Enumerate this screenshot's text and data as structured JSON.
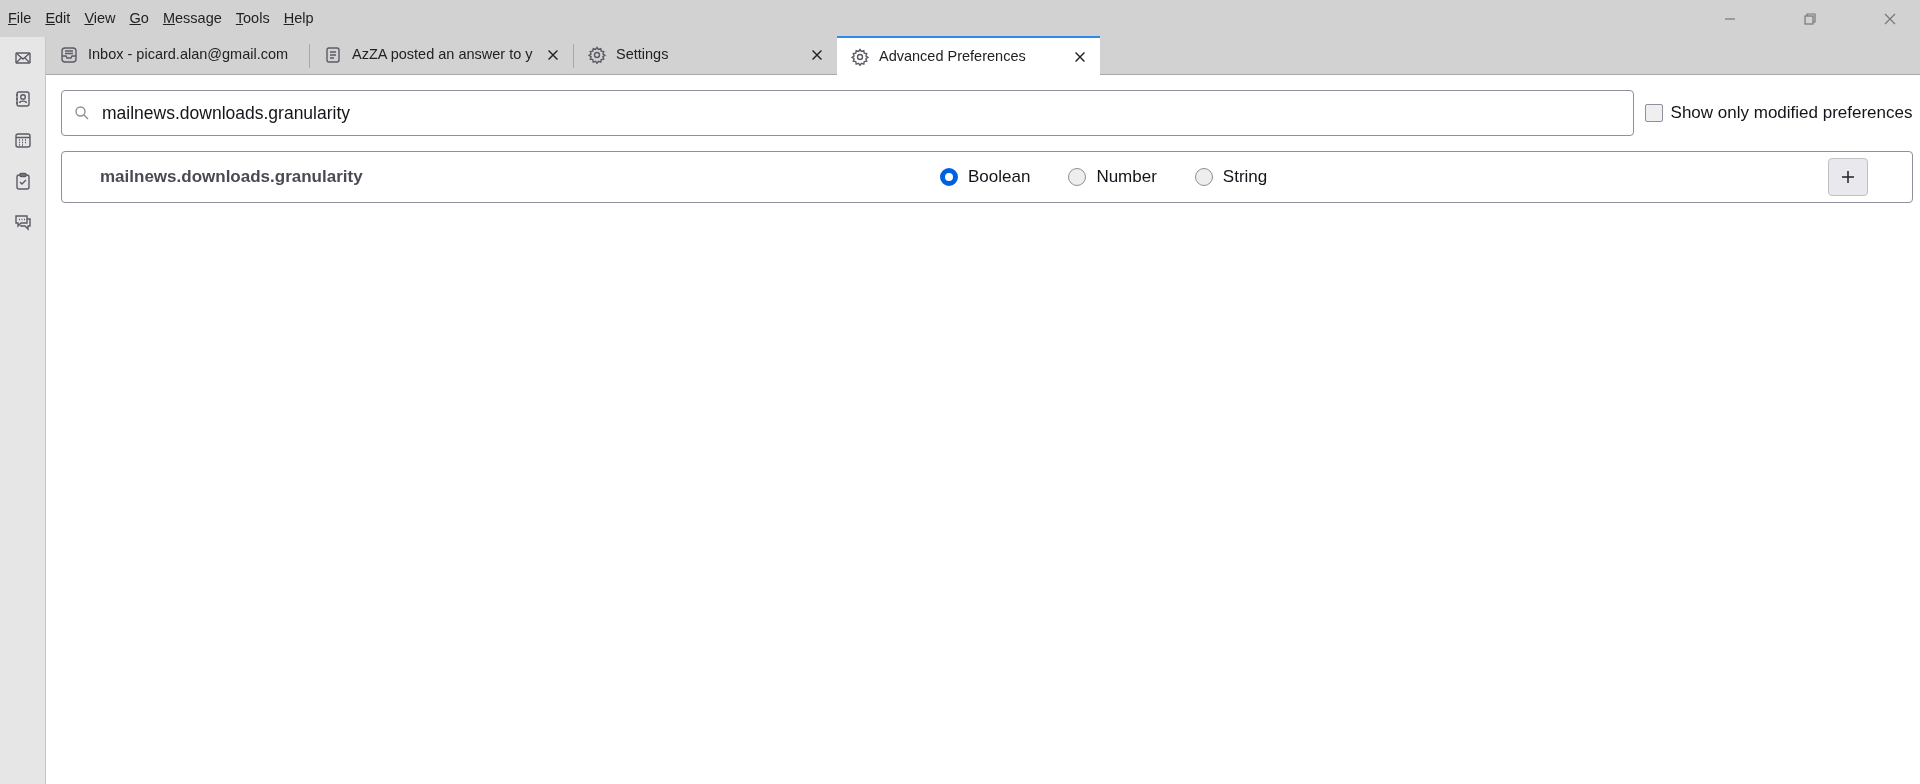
{
  "menu": [
    "File",
    "Edit",
    "View",
    "Go",
    "Message",
    "Tools",
    "Help"
  ],
  "sidebar": {
    "items": [
      {
        "kind": "mail"
      },
      {
        "kind": "contacts"
      },
      {
        "kind": "calendar"
      },
      {
        "kind": "tasks"
      },
      {
        "kind": "chat"
      }
    ]
  },
  "tabs": [
    {
      "kind": "inbox",
      "label": "Inbox - picard.alan@gmail.com",
      "selected": false,
      "closable": false
    },
    {
      "kind": "document",
      "label": "AzZA posted an answer to y",
      "selected": false,
      "closable": true
    },
    {
      "kind": "settings",
      "label": "Settings",
      "selected": false,
      "closable": true
    },
    {
      "kind": "settings",
      "label": "Advanced Preferences",
      "selected": true,
      "closable": true
    }
  ],
  "search": {
    "value": "mailnews.downloads.granularity"
  },
  "modified_only": {
    "label": "Show only modified preferences",
    "checked": false
  },
  "new_pref": {
    "name": "mailnews.downloads.granularity",
    "types": [
      {
        "label": "Boolean",
        "selected": true
      },
      {
        "label": "Number",
        "selected": false
      },
      {
        "label": "String",
        "selected": false
      }
    ]
  }
}
